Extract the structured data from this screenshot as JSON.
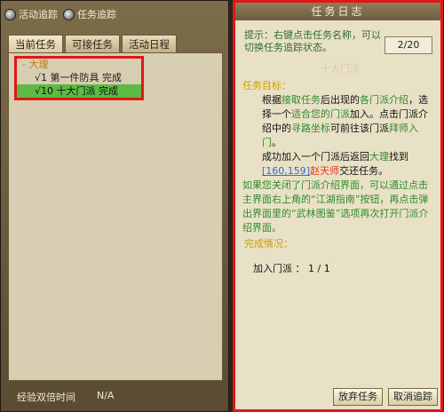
{
  "left": {
    "radio_activity": "活动追踪",
    "radio_task": "任务追踪",
    "tabs": [
      "当前任务",
      "可接任务",
      "活动日程"
    ],
    "tree": {
      "category": "- 大理",
      "items": [
        {
          "label": "√1  第一件防具  完成"
        },
        {
          "label": "√10  十大门派  完成"
        }
      ]
    },
    "footer_label": "经验双倍时间",
    "footer_value": "N/A"
  },
  "right": {
    "title": "任务日志",
    "hint": "提示：右键点击任务名称，可以切换任务追踪状态。",
    "count": "2/20",
    "faint": "十大门派",
    "goal_label": "任务目标：",
    "para1": {
      "p1": "根据",
      "p2": "接取任务",
      "p3": "后出现的",
      "p4": "各门派介绍",
      "p5": "，选择一个",
      "p6": "适合您的门派",
      "p7": "加入。点击门派介绍中的",
      "p8": "寻路坐标",
      "p9": "可前往该门派",
      "p10": "拜师入门",
      "p11": "。"
    },
    "para2": {
      "p1": "成功加入一个门派后返回",
      "p2": "大理",
      "p3": "找到",
      "p4": "[160,159]",
      "p5": "赵天师",
      "p6": "交还任务。"
    },
    "para3": "如果您关闭了门派介绍界面，可以通过点击主界面右上角的“江湖指南”按钮，再点击弹出界面里的“武林图鉴”选项再次打开门派介绍界面。",
    "complete_label": "完成情况：",
    "progress_label": "加入门派  ：  1 / 1",
    "btn_abandon": "放弃任务",
    "btn_cancel_track": "取消追踪"
  },
  "colors": {
    "highlight_border": "#e0161b",
    "selected_row": "#5bbb43",
    "gold_text": "#c9a000",
    "green_text": "#2e8b2e"
  }
}
